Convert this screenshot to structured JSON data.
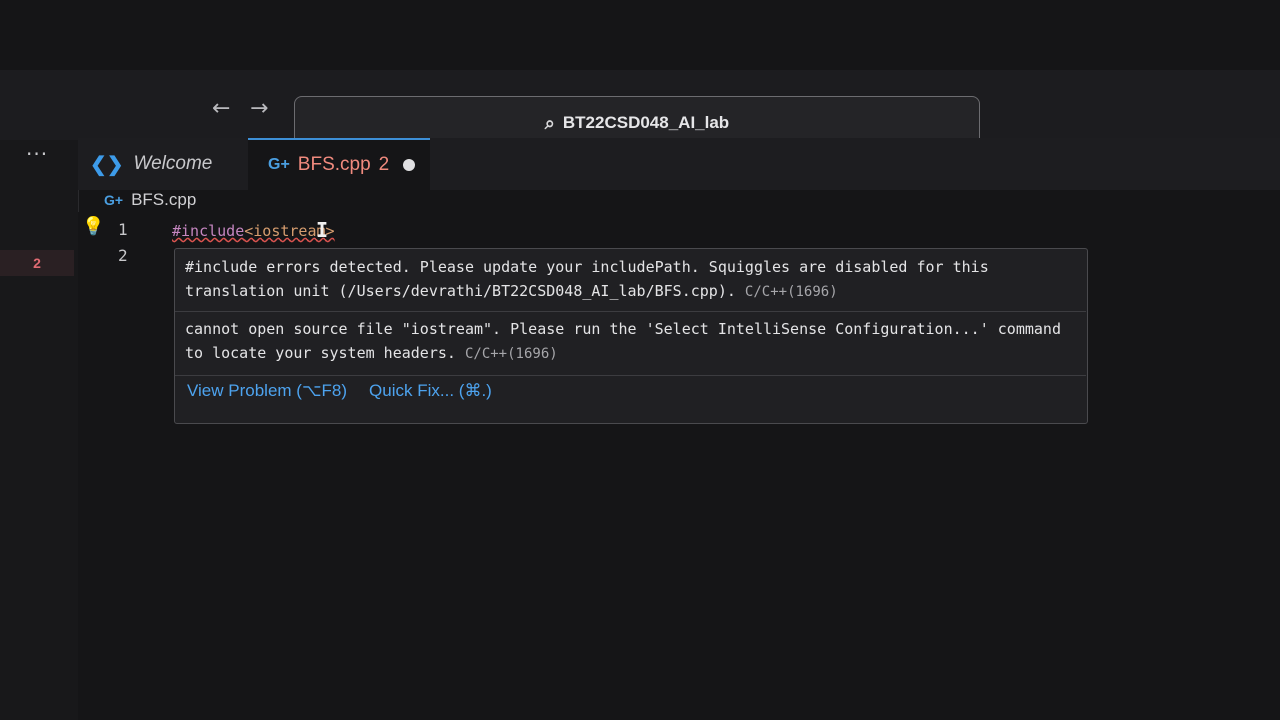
{
  "search": {
    "title": "BT22CSD048_AI_lab",
    "icon": "search-icon"
  },
  "navigation": {
    "back_icon": "arrow-left-icon",
    "forward_icon": "arrow-right-icon",
    "back_glyph": "←",
    "forward_glyph": "→"
  },
  "activity": {
    "more_glyph": "···",
    "problem_count": "2"
  },
  "tabs": [
    {
      "label": "Welcome",
      "icon": "vscode-logo-icon",
      "active": false
    },
    {
      "label": "BFS.cpp",
      "badge": "2",
      "icon": "cpp-file-icon",
      "active": true,
      "unsaved": true
    }
  ],
  "breadcrumb": {
    "file": "BFS.cpp"
  },
  "editor": {
    "line_numbers": [
      "1",
      "2"
    ],
    "line1": {
      "directive": "#include",
      "header": "<iostream>"
    }
  },
  "hover": {
    "message1": {
      "text": "#include errors detected. Please update your includePath. Squiggles are disabled for this translation unit (/Users/devrathi/BT22CSD048_AI_lab/BFS.cpp).",
      "code": "C/C++(1696)"
    },
    "message2": {
      "text": "cannot open source file \"iostream\". Please run the 'Select IntelliSense Configuration...' command to locate your system headers.",
      "code": "C/C++(1696)"
    },
    "actions": {
      "view_problem": "View Problem (⌥F8)",
      "quick_fix": "Quick Fix... (⌘.)"
    }
  },
  "colors": {
    "accent": "#3d8fd6",
    "error_tab": "#f08a7e",
    "link": "#4da3ef",
    "lightbulb": "#f2c43a"
  }
}
